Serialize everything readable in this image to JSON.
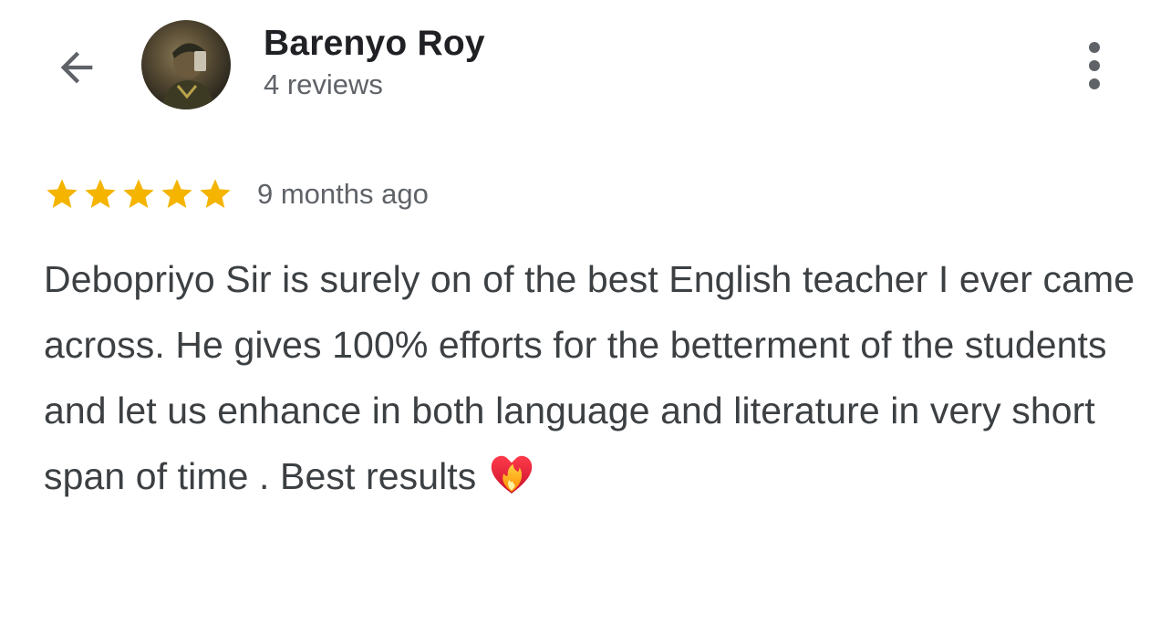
{
  "header": {
    "back_icon": "arrow-left-icon",
    "avatar_icon": "avatar",
    "reviewer_name": "Barenyo Roy",
    "review_count": "4 reviews",
    "more_icon": "more-vertical-icon"
  },
  "review": {
    "rating": 5,
    "rating_max": 5,
    "star_color": "#F4B400",
    "time_ago": "9 months ago",
    "text": "Debopriyo Sir is surely on of the best English teacher I ever came across. He gives 100% efforts for the betterment of the students and let us enhance in both language and literature in very short span of time . Best results",
    "emoji_icon": "heart-on-fire-icon"
  },
  "colors": {
    "text_primary": "#202124",
    "text_secondary": "#5f6368",
    "body_text": "#3c4043"
  }
}
